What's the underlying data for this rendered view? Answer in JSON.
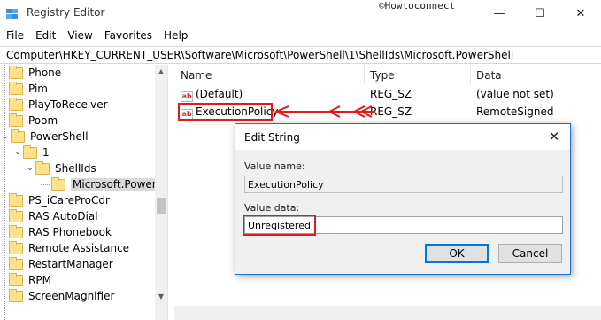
{
  "window": {
    "title": "Registry Editor",
    "watermark": "©Howtoconnect",
    "minimize_glyph": "—",
    "maximize_glyph": "☐",
    "close_glyph": "✕"
  },
  "menu": [
    "File",
    "Edit",
    "View",
    "Favorites",
    "Help"
  ],
  "address": "Computer\\HKEY_CURRENT_USER\\Software\\Microsoft\\PowerShell\\1\\ShellIds\\Microsoft.PowerShell",
  "tree": {
    "items": [
      {
        "label": "Phone"
      },
      {
        "label": "Pim"
      },
      {
        "label": "PlayToReceiver"
      },
      {
        "label": "Poom"
      },
      {
        "label": "PowerShell"
      },
      {
        "label": "1"
      },
      {
        "label": "ShellIds"
      },
      {
        "label": "Microsoft.PowerShell"
      },
      {
        "label": "PS_iCareProCdr"
      },
      {
        "label": "RAS AutoDial"
      },
      {
        "label": "RAS Phonebook"
      },
      {
        "label": "Remote Assistance"
      },
      {
        "label": "RestartManager"
      },
      {
        "label": "RPM"
      },
      {
        "label": "ScreenMagnifier"
      }
    ]
  },
  "list": {
    "columns": [
      "Name",
      "Type",
      "Data"
    ],
    "rows": [
      {
        "name": "(Default)",
        "type": "REG_SZ",
        "data": "(value not set)",
        "icon": "ab"
      },
      {
        "name": "ExecutionPolicy",
        "type": "REG_SZ",
        "data": "RemoteSigned",
        "icon": "ab"
      }
    ]
  },
  "dialog": {
    "title": "Edit String",
    "value_name_label": "Value name:",
    "value_name": "ExecutionPolicy",
    "value_data_label": "Value data:",
    "value_data": "Unregistered",
    "ok_label": "OK",
    "cancel_label": "Cancel"
  },
  "colors": {
    "annotation_red": "#e01b1b",
    "dialog_border": "#1f6fcf",
    "folder_fill": "#ffe28c",
    "default_button_border": "#0078d7"
  }
}
